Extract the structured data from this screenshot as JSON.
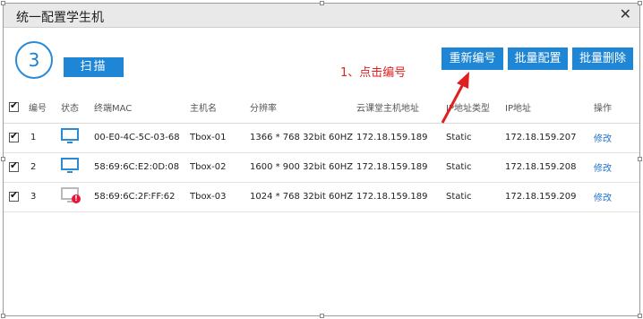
{
  "dialog": {
    "title": "统一配置学生机",
    "close_glyph": "✕"
  },
  "toolbar": {
    "count": "3",
    "scan_label": "扫描",
    "renumber_label": "重新编号",
    "batch_config_label": "批量配置",
    "batch_delete_label": "批量删除"
  },
  "annotation": {
    "text": "1、点击编号",
    "color": "#e02020"
  },
  "table": {
    "headers": {
      "number": "编号",
      "status": "状态",
      "mac": "终端MAC",
      "hostname": "主机名",
      "resolution": "分辨率",
      "server_ip": "云课堂主机地址",
      "ip_type": "IP地址类型",
      "ip": "IP地址",
      "action": "操作"
    },
    "rows": [
      {
        "checked": true,
        "number": "1",
        "status_icon": "monitor-online-icon",
        "mac": "00-E0-4C-5C-03-68",
        "hostname": "Tbox-01",
        "resolution": "1366 * 768 32bit 60HZ",
        "server_ip": "172.18.159.189",
        "ip_type": "Static",
        "ip": "172.18.159.207",
        "action": "修改"
      },
      {
        "checked": true,
        "number": "2",
        "status_icon": "monitor-online-icon",
        "mac": "58:69:6C:E2:0D:08",
        "hostname": "Tbox-02",
        "resolution": "1600 * 900 32bit 60HZ",
        "server_ip": "172.18.159.189",
        "ip_type": "Static",
        "ip": "172.18.159.208",
        "action": "修改"
      },
      {
        "checked": true,
        "number": "3",
        "status_icon": "monitor-warning-icon",
        "mac": "58:69:6C:2F:FF:62",
        "hostname": "Tbox-03",
        "resolution": "1024 * 768 32bit 60HZ",
        "server_ip": "172.18.159.189",
        "ip_type": "Static",
        "ip": "172.18.159.209",
        "action": "修改"
      }
    ]
  },
  "colors": {
    "accent": "#1f86d6",
    "link": "#1f6fd0",
    "alert": "#e8143a"
  }
}
